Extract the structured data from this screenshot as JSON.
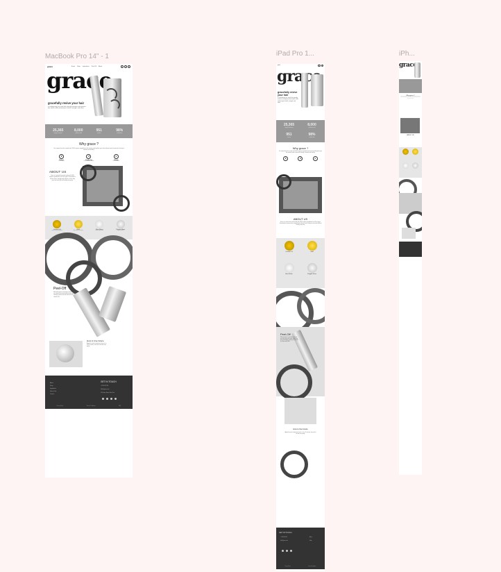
{
  "frames": {
    "mac": "MacBook Pro 14\" - 1",
    "ipad": "iPad Pro 1...",
    "iphone": "iPh..."
  },
  "brand": "grace",
  "nav": {
    "logo": "grace",
    "links": [
      "Home",
      "Shop",
      "Ingredients",
      "Peel-Off",
      "About"
    ]
  },
  "hero": {
    "tagline": "gracefully revive your hair",
    "tagline_ipad": "gracefully revive your hair",
    "description": "a revolutionary hair mask that naturally restores and improves hair health, while enhancing its health, strength, and shine."
  },
  "stats": [
    {
      "value": "25,365",
      "label": "happy customers"
    },
    {
      "value": "8,000",
      "label": "products sold"
    },
    {
      "value": "951",
      "label": "reviews"
    },
    {
      "value": "98%",
      "label": "satisfaction"
    }
  ],
  "why": {
    "title": "Why grace ?",
    "text": "Our unique formula is made with 100% organic ingredients that restore and hydrate your hair without harsh chemicals, leaving it smooth and healthy.",
    "features": [
      {
        "icon": "leaf-icon",
        "title": "Natural",
        "sub": "100% organic"
      },
      {
        "icon": "no-chemicals-icon",
        "title": "Cruelty-free",
        "sub": "never tested on animals"
      },
      {
        "icon": "drop-icon",
        "title": "Vitamin",
        "sub": "rich in nutrients"
      }
    ]
  },
  "about": {
    "title": "ABOUT US",
    "text": "Grace is a natural hair mask made with 100% organic ingredients for all hair types. Formulated to restore shine, strength and softness, and to help your hair look and feel healthy every day."
  },
  "ingredients": [
    {
      "name": "Coconut Oil",
      "desc": "nourishes and strengthens"
    },
    {
      "name": "Gold",
      "desc": "adds radiance and shine"
    },
    {
      "name": "Shea Butter",
      "desc": "softens and protects"
    },
    {
      "name": "Polyglot Glaze",
      "desc": "locks in moisture"
    }
  ],
  "peel": {
    "title": "Peel-Off",
    "text": "With peel grace's innovative formula, you can remove the mask without any mess. A soothing, gentle peel-off mask for silky smooth hair.",
    "how_title": "How to Use Grace",
    "how_text": "Apply the mask to damp hair, leave it on for 15 minutes, then peel it off and rinse gently."
  },
  "footer": {
    "links": [
      "About",
      "Shop",
      "Ingredients",
      "How to Use",
      "Contact"
    ],
    "get_in_touch": "GET IN TOUCH",
    "contacts": [
      "+1 234 567 890",
      "hello@grace.com",
      "123 Grace Street, New York"
    ],
    "bottom": [
      "Privacy Policy",
      "Terms & Conditions",
      "FAQ"
    ]
  },
  "colors": {
    "canvas": "#fff4f4",
    "stats_bg": "#999999",
    "ingredients_bg": "#e6e6e6",
    "footer_bg": "#333333"
  }
}
